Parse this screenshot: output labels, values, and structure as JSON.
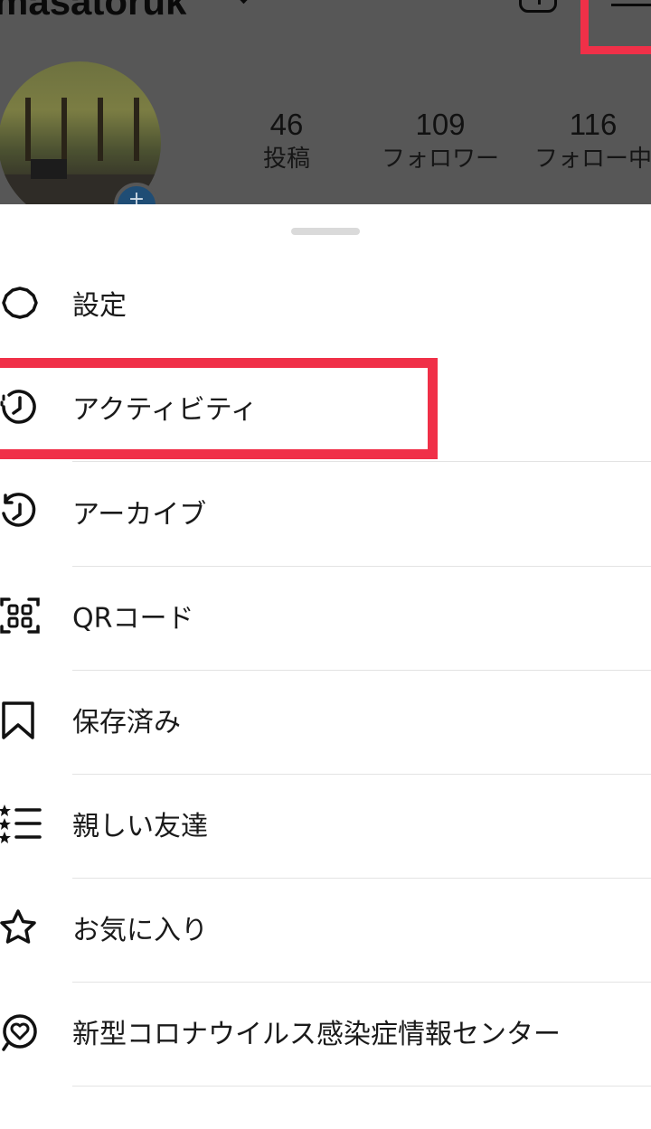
{
  "profile": {
    "username": "masatoruk",
    "stats": [
      {
        "count": "46",
        "label": "投稿"
      },
      {
        "count": "109",
        "label": "フォロワー"
      },
      {
        "count": "116",
        "label": "フォロー中"
      }
    ]
  },
  "menu": {
    "items": [
      {
        "label": "設定",
        "icon": "gear-icon"
      },
      {
        "label": "アクティビティ",
        "icon": "activity-clock-icon"
      },
      {
        "label": "アーカイブ",
        "icon": "archive-clock-icon"
      },
      {
        "label": "QRコード",
        "icon": "qr-scan-icon"
      },
      {
        "label": "保存済み",
        "icon": "bookmark-icon"
      },
      {
        "label": "親しい友達",
        "icon": "close-friends-list-icon"
      },
      {
        "label": "お気に入り",
        "icon": "star-icon"
      },
      {
        "label": "新型コロナウイルス感染症情報センター",
        "icon": "covid-info-heart-icon"
      }
    ]
  },
  "colors": {
    "highlight": "#f03048",
    "overlay": "#575757"
  }
}
